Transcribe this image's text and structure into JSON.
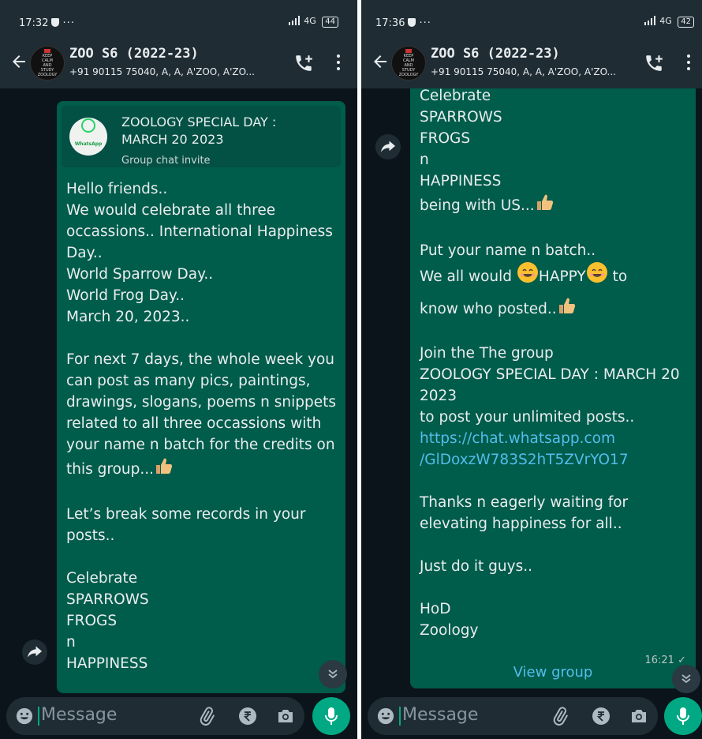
{
  "left": {
    "status": {
      "time": "17:32",
      "dots": "···",
      "network": "4G",
      "battery": "44"
    },
    "header": {
      "group_name": "ZOO S6 (2022-23)",
      "participants": "+91 90115 75040, A, A, A'ZOO, A'ZO..."
    },
    "invite": {
      "title": "ZOOLOGY SPECIAL DAY : MARCH 20 2023",
      "subtitle": "Group chat invite",
      "logo_text": "WhatsApp"
    },
    "message": "Hello friends..\nWe would celebrate all three occassions.. International Happiness Day..\nWorld Sparrow Day..\nWorld Frog Day..\nMarch 20, 2023..\n\nFor next 7 days, the whole week you can post as many pics, paintings, drawings, slogans, poems n snippets related to all three occassions with your name n batch for the credits on this group...",
    "message_b": "Let’s break some records in your posts..\n\nCelebrate\nSPARROWS\nFROGS\nn\nHAPPINESS",
    "input_placeholder": "Message"
  },
  "right": {
    "status": {
      "time": "17:36",
      "dots": "···",
      "network": "4G",
      "battery": "42"
    },
    "header": {
      "group_name": "ZOO S6 (2022-23)",
      "participants": "+91 90115 75040, A, A, A'ZOO, A'ZO..."
    },
    "msg_a": "Celebrate\nSPARROWS\nFROGS\nn\nHAPPINESS\nbeing with US...",
    "msg_b1": "Put your name n batch..",
    "msg_b2": "We all would",
    "msg_b3": "HAPPY",
    "msg_b4": "to",
    "msg_b5": "know who posted..",
    "msg_c": "Join the The group\nZOOLOGY SPECIAL DAY : MARCH 20 2023\nto post your unlimited posts..",
    "link1": "https://chat.whatsapp.com",
    "link2": "/GlDoxzW783S2hT5ZVrYO17",
    "msg_d": "Thanks n eagerly waiting for elevating happiness for all..\n\nJust do it guys..\n\nHoD\nZoology",
    "timestamp": "16:21",
    "view_group": "View group",
    "input_placeholder": "Message"
  },
  "colors": {
    "bubble": "#005c4b",
    "background": "#0b141a",
    "header": "#1f2c34",
    "accent": "#00a884",
    "link": "#53bdeb"
  },
  "icons": [
    "back-arrow-icon",
    "add-call-icon",
    "more-vert-icon",
    "forward-icon",
    "scroll-down-icon",
    "emoji-icon",
    "attach-icon",
    "rupee-icon",
    "camera-icon",
    "mic-icon",
    "thumbs-up-emoji",
    "smiling-face-emoji"
  ]
}
